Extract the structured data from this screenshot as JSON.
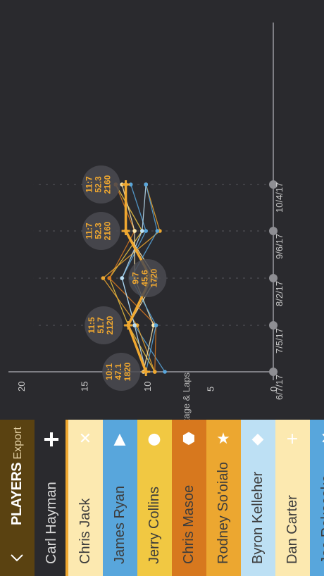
{
  "header": {
    "title": "PLAYERS",
    "export_label": "Export",
    "back_icon": "chevron-left-icon"
  },
  "current_player": {
    "name": "Carl Hayman",
    "icon": "plus-icon",
    "accent_color": "#f0a830"
  },
  "players": [
    {
      "name": "Chris Jack",
      "icon": "cross-icon",
      "symbol": "✕",
      "color": "#fce9b0"
    },
    {
      "name": "James Ryan",
      "icon": "triangle-icon",
      "symbol": "▲",
      "color": "#58a6dc"
    },
    {
      "name": "Jerry Collins",
      "icon": "circle-icon",
      "symbol": "●",
      "color": "#f1c842"
    },
    {
      "name": "Chris Masoe",
      "icon": "hexagon-icon",
      "symbol": "⬢",
      "color": "#d7781e"
    },
    {
      "name": "Rodney So'oialo",
      "icon": "star-icon",
      "symbol": "★",
      "color": "#eca730"
    },
    {
      "name": "Byron Kelleher",
      "icon": "diamond-icon",
      "symbol": "◆",
      "color": "#bde0f4"
    },
    {
      "name": "Dan Carter",
      "icon": "plus-icon",
      "symbol": "+",
      "color": "#fce9b0"
    },
    {
      "name": "Joe Rokocoko",
      "icon": "cross-icon",
      "symbol": "✕",
      "color": "#58a6dc"
    }
  ],
  "chart_data": {
    "type": "line",
    "orientation": "rotated-90",
    "xlabel": "Stage & Laps",
    "categories": [
      "6/7/17",
      "7/5/17",
      "8/2/17",
      "9/6/17",
      "10/4/17"
    ],
    "ylim": [
      0,
      20
    ],
    "y_ticks": [
      0,
      5,
      10,
      15,
      20
    ],
    "highlight_series": "Carl Hayman",
    "series": [
      {
        "name": "Carl Hayman",
        "values": [
          10.1,
          11.5,
          9.7,
          11.7,
          11.7
        ],
        "color": "#f0a830",
        "highlighted": true
      },
      {
        "name": "Chris Jack",
        "values": [
          10.1,
          11.5,
          9.3,
          11.7,
          11.7
        ],
        "color": "#fce9b0"
      },
      {
        "name": "James Ryan",
        "values": [
          8.6,
          11.0,
          12.0,
          10.1,
          11.3
        ],
        "color": "#58a6dc"
      },
      {
        "name": "Jerry Collins",
        "values": [
          9.4,
          11.5,
          13.0,
          10.4,
          12.5
        ],
        "color": "#f1c842"
      },
      {
        "name": "Chris Masoe",
        "values": [
          9.4,
          9.3,
          13.0,
          11.0,
          12.5
        ],
        "color": "#d7781e"
      },
      {
        "name": "Rodney So'oialo",
        "values": [
          9.4,
          10.8,
          13.5,
          9.0,
          10.1
        ],
        "color": "#eca730"
      },
      {
        "name": "Byron Kelleher",
        "values": [
          10.1,
          11.0,
          12.0,
          10.4,
          10.1
        ],
        "color": "#bde0f4"
      },
      {
        "name": "Dan Carter",
        "values": [
          10.3,
          9.5,
          11.0,
          11.0,
          12.0
        ],
        "color": "#fce9b0"
      },
      {
        "name": "Joe Rokocoko",
        "values": [
          10.1,
          9.3,
          11.3,
          9.2,
          10.1
        ],
        "color": "#58a6dc"
      }
    ],
    "annotations": [
      {
        "category": "6/7/17",
        "lines": [
          "10:1",
          "47.1",
          "1820"
        ]
      },
      {
        "category": "7/5/17",
        "lines": [
          "11:5",
          "51.7",
          "2120"
        ]
      },
      {
        "category": "8/2/17",
        "lines": [
          "9:7",
          "45.6",
          "1720"
        ]
      },
      {
        "category": "9/6/17",
        "lines": [
          "11:7",
          "52.3",
          "2160"
        ]
      },
      {
        "category": "10/4/17",
        "lines": [
          "11:7",
          "52.3",
          "2160"
        ]
      }
    ]
  }
}
